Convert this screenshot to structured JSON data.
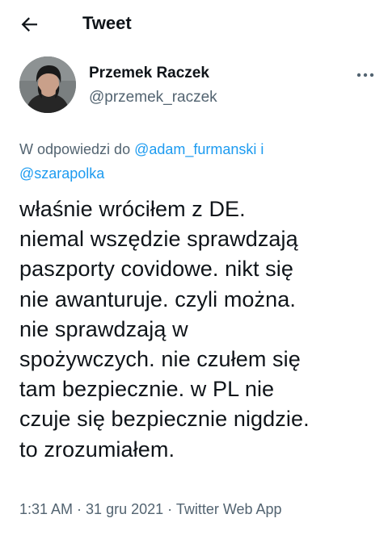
{
  "header": {
    "title": "Tweet",
    "back_icon": "arrow-left-icon"
  },
  "author": {
    "name": "Przemek Raczek",
    "handle": "@przemek_raczek",
    "more_icon": "more-horizontal-icon"
  },
  "reply": {
    "prefix": "W odpowiedzi do ",
    "user1": "@adam_furmanski",
    "joiner": " i",
    "user2": "@szarapolka"
  },
  "tweet": {
    "text": "właśnie wróciłem z DE.\nniemal wszędzie sprawdzają\npaszporty covidowe. nikt się\nnie awanturuje. czyli można.\nnie sprawdzają w\nspożywczych. nie czułem się\ntam bezpiecznie. w PL nie\nczuje się bezpiecznie nigdzie.\nto zrozumiałem."
  },
  "meta": {
    "time": "1:31 AM",
    "date": "31 gru 2021",
    "source": "Twitter Web App",
    "separator": " · "
  },
  "colors": {
    "text": "#0f1419",
    "secondary": "#536471",
    "link": "#1d9bf0"
  }
}
